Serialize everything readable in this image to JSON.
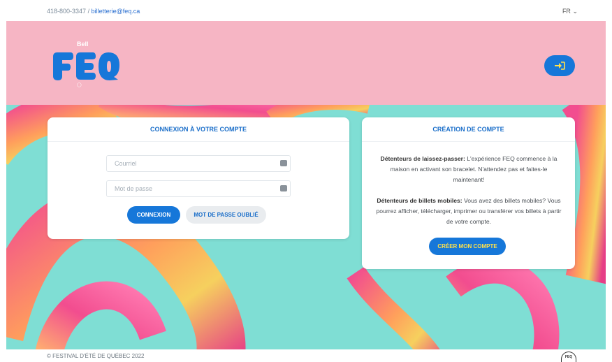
{
  "topbar": {
    "phone": "418-800-3347",
    "separator": " / ",
    "email": "billetterie@feq.ca",
    "language": "FR",
    "language_icon": "chevron-down-icon"
  },
  "header": {
    "logo_sponsor": "Bell",
    "logo_text": "FEQ",
    "login_icon": "sign-in-icon"
  },
  "login_card": {
    "title": "CONNEXION À VOTRE COMPTE",
    "email_placeholder": "Courriel",
    "password_placeholder": "Mot de passe",
    "login_button": "CONNEXION",
    "forgot_button": "MOT DE PASSE OUBLIÉ"
  },
  "create_card": {
    "title": "CRÉATION DE COMPTE",
    "pass_holders_label": "Détenteurs de laissez-passer:",
    "pass_holders_text": " L'expérience FEQ commence à la maison en activant son bracelet. N'attendez pas et faites-le maintenant!",
    "mobile_holders_label": "Détenteurs de billets mobiles:",
    "mobile_holders_text": " Vous avez des billets mobiles? Vous pourrez afficher, télécharger, imprimer ou transférer vos billets à partir de votre compte.",
    "create_button": "CRÉER MON COMPTE"
  },
  "footer": {
    "copyright": "© FESTIVAL D'ÉTÉ DE QUÉBEC 2022",
    "logo_text": "FEQ"
  },
  "colors": {
    "header_pink": "#f6b5c4",
    "brand_blue": "#1677d9",
    "hero_teal": "#7fded4",
    "accent_yellow": "#ffe14a"
  }
}
